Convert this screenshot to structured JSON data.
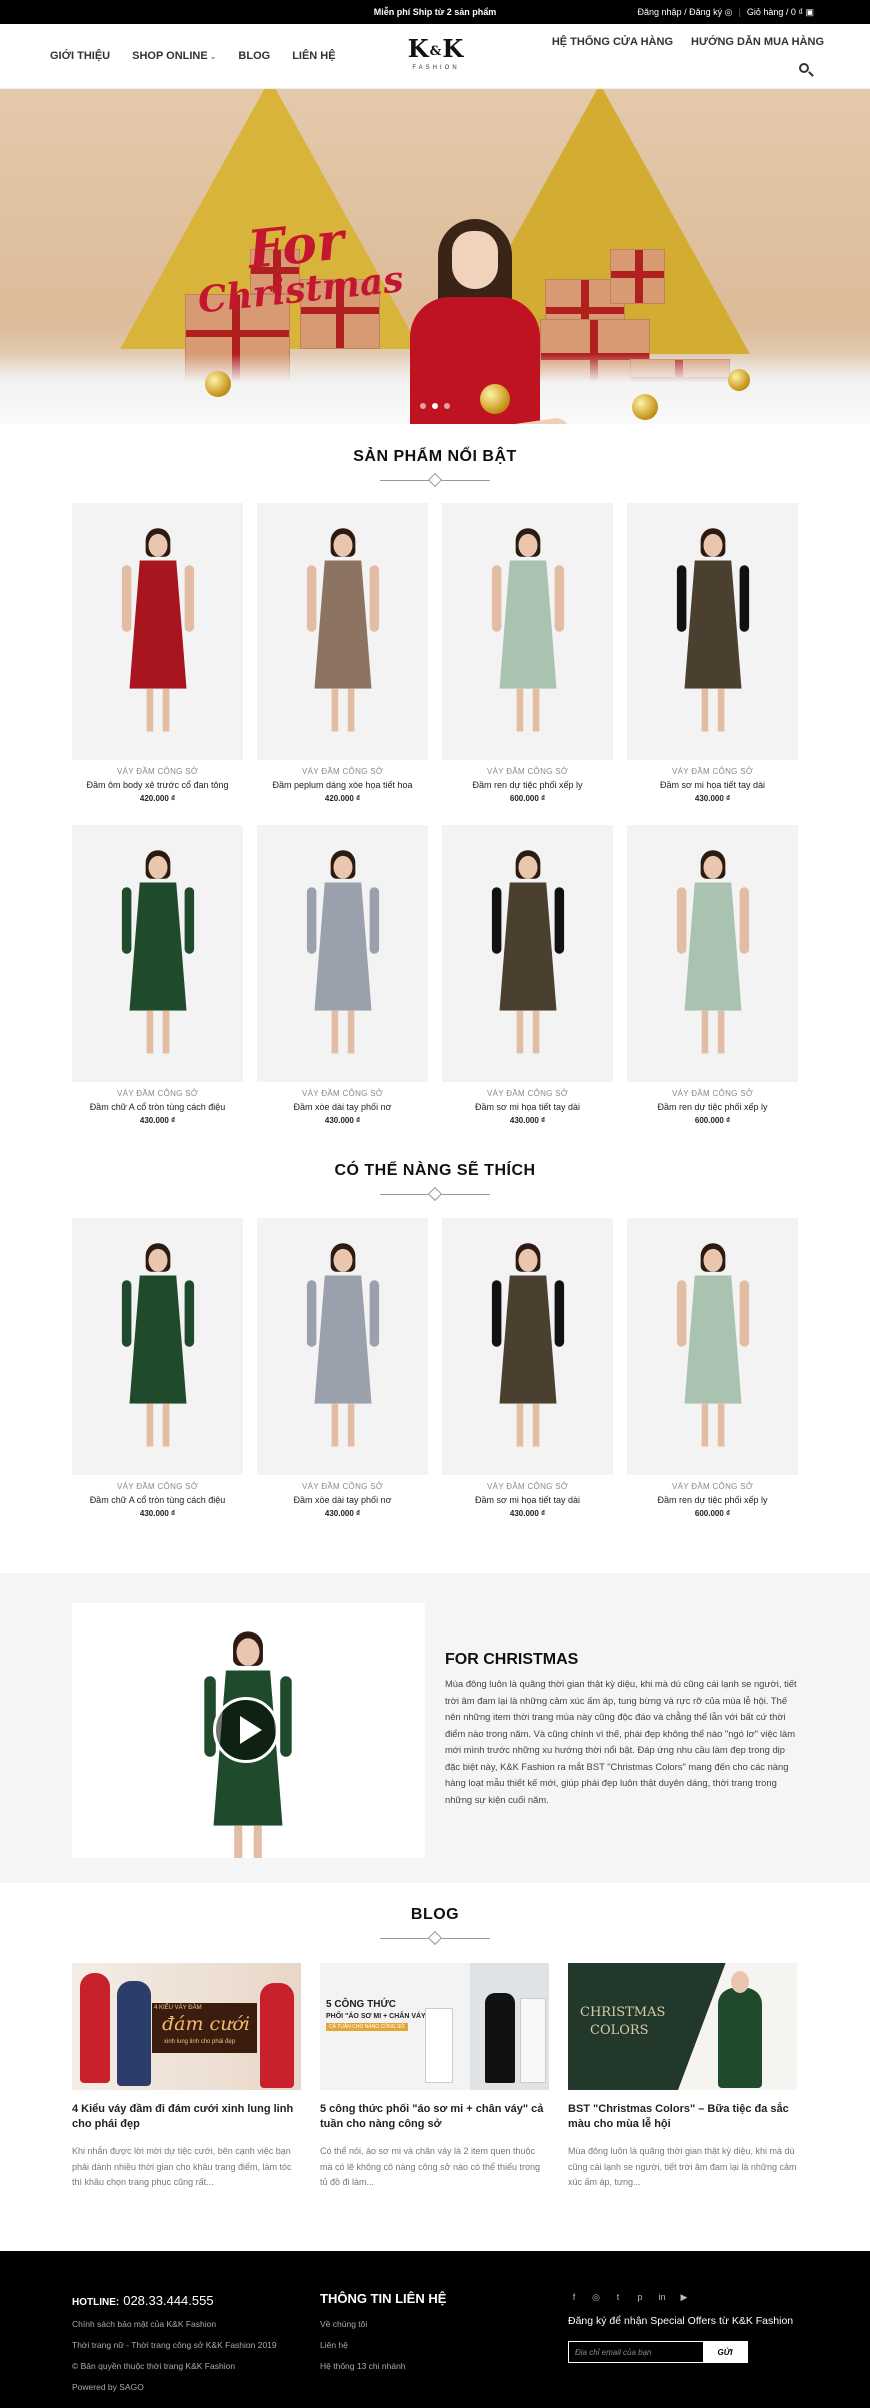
{
  "topbar": {
    "promo": "Miễn phí Ship từ 2 sản phẩm",
    "account": "Đăng nhập / Đăng ký",
    "cart": "Giỏ hàng / 0 ₫"
  },
  "nav": {
    "left": [
      "GIỚI THIỆU",
      "SHOP ONLINE",
      "BLOG",
      "LIÊN HỆ"
    ],
    "right": [
      "HỆ THỐNG CỬA HÀNG",
      "HƯỚNG DẪN MUA HÀNG"
    ]
  },
  "logo": {
    "main": "K&K",
    "k1": "K",
    "amp": "&",
    "k2": "K",
    "sub": "FASHION"
  },
  "hero": {
    "line1": "For",
    "line2": "Christmas"
  },
  "featured": {
    "title": "SẢN PHẨM NỔI BẬT",
    "products": [
      {
        "category": "VÁY ĐẦM CÔNG SỞ",
        "name": "Đầm ôm body xẻ trước cổ đan tông",
        "price": "420.000 ₫",
        "color": "#a8151f",
        "arms": "#e2bda3"
      },
      {
        "category": "VÁY ĐẦM CÔNG SỞ",
        "name": "Đầm peplum dáng xòe họa tiết hoa",
        "price": "420.000 ₫",
        "color": "#8d7462",
        "arms": "#e2bda3"
      },
      {
        "category": "VÁY ĐẦM CÔNG SỞ",
        "name": "Đầm ren dự tiệc phối xếp ly",
        "price": "600.000 ₫",
        "color": "#a9c3b0",
        "arms": "#e2bda3"
      },
      {
        "category": "VÁY ĐẦM CÔNG SỞ",
        "name": "Đầm sơ mi họa tiết tay dài",
        "price": "430.000 ₫",
        "color": "#4b4030",
        "arms": "#111111"
      },
      {
        "category": "VÁY ĐẦM CÔNG SỞ",
        "name": "Đầm chữ A cổ tròn tùng cách điệu",
        "price": "430.000 ₫",
        "color": "#1f4a2c",
        "arms": "#1f4a2c"
      },
      {
        "category": "VÁY ĐẦM CÔNG SỞ",
        "name": "Đầm xòe dài tay phối nơ",
        "price": "430.000 ₫",
        "color": "#9aa1ad",
        "arms": "#9aa1ad"
      },
      {
        "category": "VÁY ĐẦM CÔNG SỞ",
        "name": "Đầm sơ mi họa tiết tay dài",
        "price": "430.000 ₫",
        "color": "#4b4030",
        "arms": "#111111"
      },
      {
        "category": "VÁY ĐẦM CÔNG SỞ",
        "name": "Đầm ren dự tiệc phối xếp ly",
        "price": "600.000 ₫",
        "color": "#a9c3b0",
        "arms": "#e2bda3"
      }
    ]
  },
  "liked": {
    "title": "CÓ THỂ NÀNG SẼ THÍCH",
    "products": [
      {
        "category": "VÁY ĐẦM CÔNG SỞ",
        "name": "Đầm chữ A cổ tròn tùng cách điệu",
        "price": "430.000 ₫",
        "color": "#1f4a2c",
        "arms": "#1f4a2c"
      },
      {
        "category": "VÁY ĐẦM CÔNG SỞ",
        "name": "Đầm xòe dài tay phối nơ",
        "price": "430.000 ₫",
        "color": "#9aa1ad",
        "arms": "#9aa1ad"
      },
      {
        "category": "VÁY ĐẦM CÔNG SỞ",
        "name": "Đầm sơ mi họa tiết tay dài",
        "price": "430.000 ₫",
        "color": "#4b4030",
        "arms": "#111111"
      },
      {
        "category": "VÁY ĐẦM CÔNG SỞ",
        "name": "Đầm ren dự tiệc phối xếp ly",
        "price": "600.000 ₫",
        "color": "#a9c3b0",
        "arms": "#e2bda3"
      }
    ]
  },
  "feature": {
    "title": "FOR CHRISTMAS",
    "text": "Mùa đông luôn là quãng thời gian thật kỳ diệu, khi mà dù cũng cái lạnh se người, tiết trời âm đam lại là những cảm xúc ấm áp, tung bừng và rực rỡ của mùa lễ hội. Thế nên những item thời trang mùa này cũng độc đáo và chẳng thể lẫn với bất cứ thời điểm nào trong năm. Và cũng chính vì thế, phái đẹp không thể nào \"ngó lơ\" việc làm mới mình trước những xu hướng thời nổi bật. Đáp ứng nhu cầu làm đẹp trong dịp đặc biệt này, K&K Fashion ra mắt BST \"Christmas Colors\" mang đến cho các nàng hàng loạt mẫu thiết kế mới, giúp phái đẹp luôn thật duyên dáng, thời trang trong những sự kiện cuối năm."
  },
  "blog": {
    "title": "BLOG",
    "posts": [
      {
        "title": "4 Kiểu váy đầm đi đám cưới xinh lung linh cho phái đẹp",
        "excerpt": "Khi nhắn được lời mời dự tiệc cưới, bên cạnh việc bạn phải dành nhiều thời gian cho khâu trang điểm, làm tóc thì khâu chọn trang phục cũng rất...",
        "thumb_line1": "4 KIỂU VÁY ĐẦM",
        "thumb_line2": "đám cưới",
        "thumb_line3": "xinh lung linh cho phái đẹp"
      },
      {
        "title": "5 công thức phối \"áo sơ mi + chân váy\" cả tuần cho nàng công sở",
        "excerpt": "Có thể nói, áo sơ mi và chân váy là 2 item quen thuộc mà có lẽ không cô nàng công sở nào có thể thiếu trong tủ đồ đi làm...",
        "thumb_line1": "5 CÔNG THỨC",
        "thumb_line2": "PHỐI \"ÁO SƠ MI + CHÂN VÁY\"",
        "thumb_line3": "CẢ TUẦN CHO NÀNG CÔNG SỞ"
      },
      {
        "title": "BST \"Christmas Colors\" – Bữa tiệc đa sắc màu cho mùa lễ hội",
        "excerpt": "Mùa đông luôn là quãng thời gian thật kỳ diệu, khi mà dù cũng cái lạnh se người, tiết trời âm đam lại là những cảm xúc ấm áp, tưng...",
        "thumb_line1": "CHRISTMAS",
        "thumb_line2": "COLORS",
        "thumb_line3": ""
      }
    ]
  },
  "footer": {
    "hotline_label": "HOTLINE:",
    "hotline": "028.33.444.555",
    "links1": [
      "Chính sách bảo mật của K&K Fashion",
      "Thời trang nữ - Thời trang công sở K&K Fashion 2019",
      "© Bản quyền thuộc thời trang K&K Fashion",
      "Powered by SAGO"
    ],
    "info_title": "THÔNG TIN LIÊN HỆ",
    "links2": [
      "Về chúng tôi",
      "Liên hệ",
      "Hệ thống 13 chi nhánh"
    ],
    "socials": [
      "f",
      "◎",
      "t",
      "p",
      "in",
      "▶"
    ],
    "cta": "Đăng ký để nhận Special Offers từ K&K Fashion",
    "email_placeholder": "Địa chỉ email của bạn",
    "submit": "GỬI"
  }
}
